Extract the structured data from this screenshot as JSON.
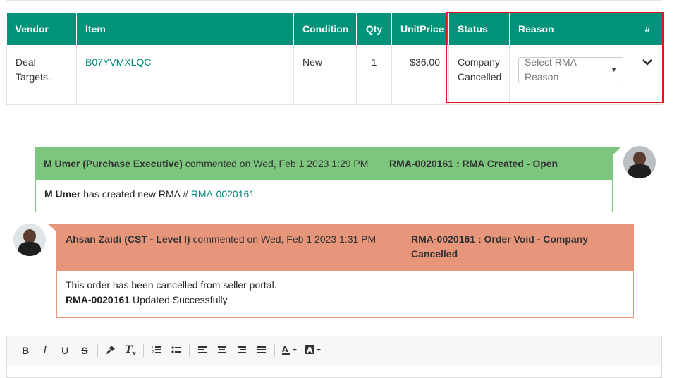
{
  "table": {
    "headers": [
      "Vendor",
      "Item",
      "Condition",
      "Qty",
      "UnitPrice",
      "Status",
      "Reason",
      "#"
    ],
    "row": {
      "vendor": "Deal Targets.",
      "item": "B07YVMXLQC",
      "condition": "New",
      "qty": "1",
      "unit_price": "$36.00",
      "status": "Company Cancelled",
      "reason_placeholder": "Select RMA Reason",
      "action_icon": "chevron-down-icon"
    }
  },
  "comments": [
    {
      "author": "M Umer (Purchase Executive)",
      "meta": "commented on Wed, Feb 1 2023 1:29 PM",
      "title": "RMA-0020161 : RMA Created - Open",
      "body_bold": "M Umer",
      "body_text": "has created new RMA #",
      "body_link": "RMA-0020161",
      "color": "#7dc67e"
    },
    {
      "author": "Ahsan Zaidi (CST - Level I)",
      "meta": "commented on Wed, Feb 1 2023 1:31 PM",
      "title": "RMA-0020161 : Order Void - Company Cancelled",
      "body_line1": "This order has been cancelled from seller portal.",
      "body_bold": "RMA-0020161",
      "body_text": "Updated Successfully",
      "color": "#e8967b"
    }
  ],
  "editor": {
    "tools": [
      "B",
      "I",
      "U",
      "S",
      "T"
    ]
  },
  "colors": {
    "header": "#009379",
    "highlight": "#e3141b",
    "link": "#00897b"
  }
}
